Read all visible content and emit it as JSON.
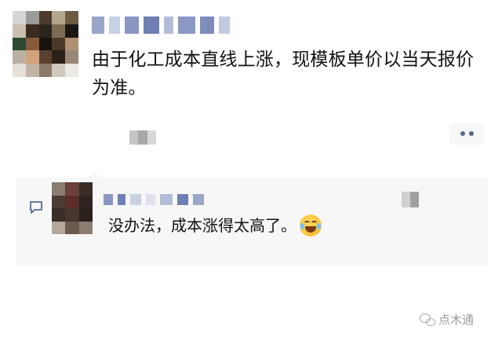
{
  "post": {
    "text": "由于化工成本直线上涨，现模板单价以当天报价为准。",
    "avatar_blur": [
      "#d6d6d6",
      "#9a9a9a",
      "#4e3a2c",
      "#b2a68c",
      "#6c5a44",
      "#c7c0b0",
      "#3a2a20",
      "#2b241c",
      "#7d6a52",
      "#1c1814",
      "#2e4a34",
      "#8a5a3c",
      "#1a1410",
      "#4a3828",
      "#b09070",
      "#b8b0a0",
      "#d4a27a",
      "#5a4030",
      "#2a2018",
      "#9a8878",
      "#e4e0d8",
      "#c0b4a4",
      "#8c7a68",
      "#d0c8bc",
      "#ece8e2"
    ],
    "name_blur": [
      "#9aa6c8",
      "#c8d0e4",
      "#8a97c2",
      "#6e7fb4",
      "#b4bdd8",
      "#8c98c4",
      "#7e8cbc",
      "#c2cae2"
    ],
    "time_blur": [
      "#c4c4c4",
      "#a8a8a8",
      "#d8d8d8"
    ],
    "more_icon": "more-dots"
  },
  "comment": {
    "text": "没办法，成本涨得太高了。",
    "emoji": "rofl-emoji",
    "avatar_blur": [
      "#8a7c70",
      "#6a4038",
      "#3a2c26",
      "#4c3c34",
      "#5c2e28",
      "#2c2420",
      "#3a2e28",
      "#463630",
      "#2a201c",
      "#b4a89c",
      "#6c5a4e",
      "#8c7c70"
    ],
    "name_blur": [
      "#8a97c2",
      "#7080b4",
      "#c8d0e4",
      "#dde2ee",
      "#b4bdd8",
      "#6e7fb4",
      "#9aa6c8"
    ],
    "time_blur": [
      "#d0d0d0",
      "#a0a0a0"
    ]
  },
  "watermark": {
    "text": "点木通"
  }
}
